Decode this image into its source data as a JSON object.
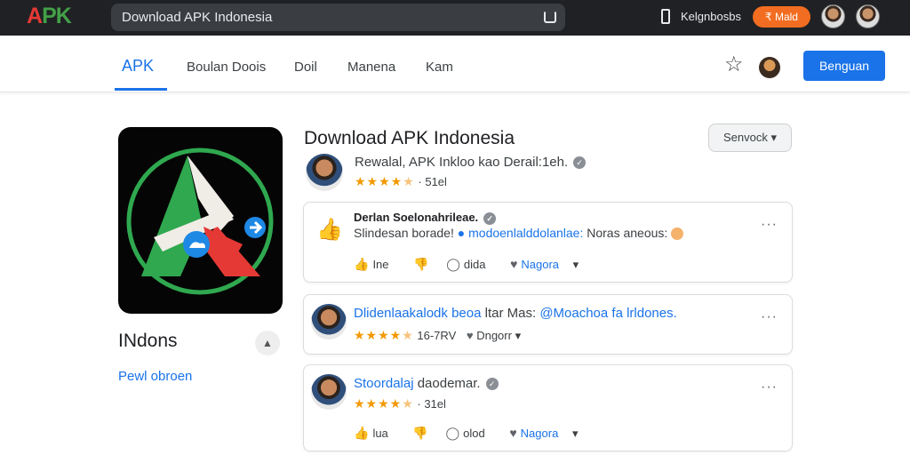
{
  "topbar": {
    "search_text": "Download APK Indonesia",
    "top_link": "Kelgnbosbs",
    "orange_button": "₹ Mald"
  },
  "nav": {
    "items": [
      {
        "label": "APK"
      },
      {
        "label": "Boulan Doois"
      },
      {
        "label": "Doil"
      },
      {
        "label": "Manena"
      },
      {
        "label": "Kam"
      }
    ],
    "primary_button": "Benguan"
  },
  "app": {
    "name": "INdons",
    "link": "Pewl obroen"
  },
  "header": {
    "title": "Download APK Indonesia",
    "developer_line": "Rewalal, APK Inkloo kao Derail:1eh.",
    "rating_text": "· 51el",
    "sort_label": "Senvock"
  },
  "reviews": [
    {
      "author": "Derlan Soelonahrileae.",
      "text_prefix": "Slindesan borade!",
      "text_blue": "modoenlalddolanlae:",
      "text_suffix": "Noras aneous:",
      "actions": {
        "like": "Ine",
        "dislike": "",
        "comment": "dida",
        "reply": "Nagora"
      }
    },
    {
      "headline_blue": "Dlidenlaakalodk beoa",
      "headline_dark": "ltar",
      "headline_rest": "Mas:",
      "headline_end": "@Moachoa fa lrldones.",
      "rating_text": "16-7RV",
      "dropdown": "Dngorr"
    },
    {
      "author_blue": "Stoordalaj",
      "author_dark": "daodemar.",
      "rating_text": "· 31el",
      "actions": {
        "like": "lua",
        "dislike": "",
        "comment": "olod",
        "reply": "Nagora"
      }
    }
  ]
}
